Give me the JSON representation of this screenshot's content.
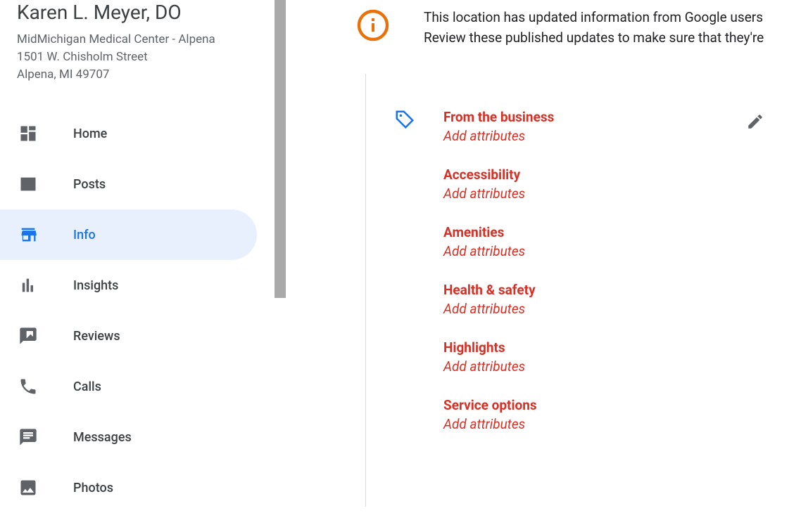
{
  "business": {
    "name": "Karen L. Meyer, DO",
    "address_line1": "MidMichigan Medical Center - Alpena",
    "address_line2": "1501 W. Chisholm Street",
    "address_line3": "Alpena, MI 49707"
  },
  "nav": {
    "home": "Home",
    "posts": "Posts",
    "info": "Info",
    "insights": "Insights",
    "reviews": "Reviews",
    "calls": "Calls",
    "messages": "Messages",
    "photos": "Photos"
  },
  "banner": {
    "line1": "This location has updated information from Google users",
    "line2": "Review these published updates to make sure that they're"
  },
  "attributes": {
    "from_business": {
      "title": "From the business",
      "link": "Add attributes"
    },
    "accessibility": {
      "title": "Accessibility",
      "link": "Add attributes"
    },
    "amenities": {
      "title": "Amenities",
      "link": "Add attributes"
    },
    "health_safety": {
      "title": "Health & safety",
      "link": "Add attributes"
    },
    "highlights": {
      "title": "Highlights",
      "link": "Add attributes"
    },
    "service_options": {
      "title": "Service options",
      "link": "Add attributes"
    }
  }
}
